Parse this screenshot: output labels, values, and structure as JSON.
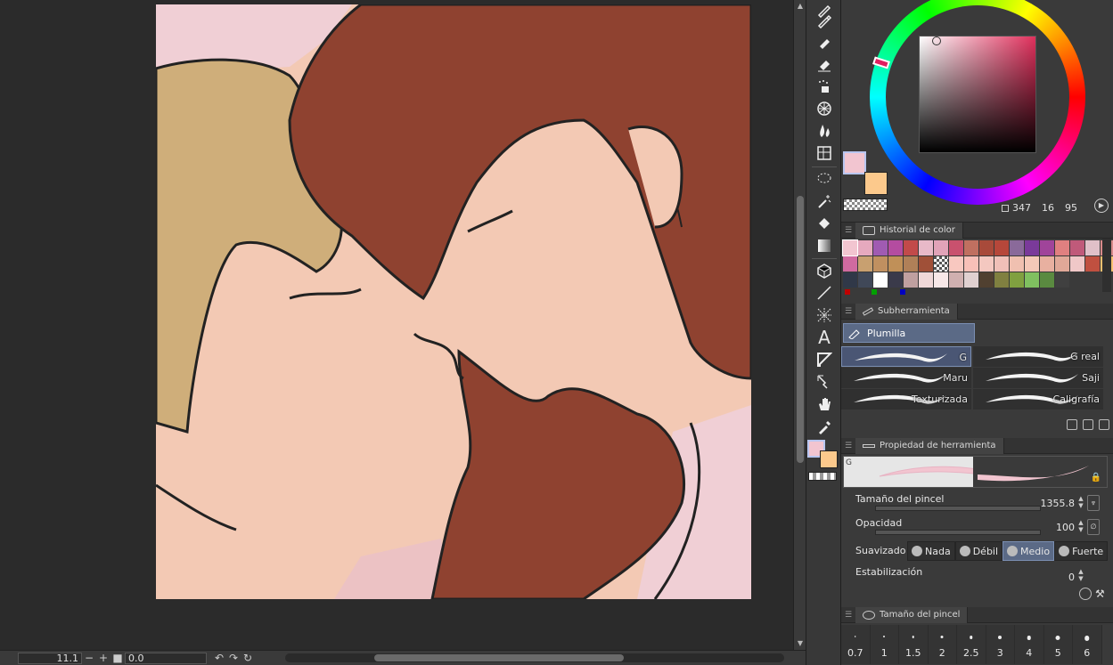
{
  "status_bar": {
    "zoom": "11.1",
    "rotation": "0.0"
  },
  "color_wheel": {
    "main_color": "#f2c5d0",
    "sub_color": "#fcc98c",
    "h": "347",
    "s": "16",
    "v": "95"
  },
  "color_history": {
    "tab_label": "Historial de color",
    "swatches": [
      "#f2c5d0",
      "#e6a9be",
      "#a05bb2",
      "#b44ca0",
      "#c24a4a",
      "#e8b9c8",
      "#e1a3b8",
      "#c9516e",
      "#c07060",
      "#a84a3a",
      "#b6473a",
      "#8a6a9a",
      "#7a3a9a",
      "#a0449a",
      "#e08080",
      "#c05a7a",
      "#e0c0c8",
      "#d98a8a",
      "#d06aa0",
      "#c8a070",
      "#c09060",
      "#c09058",
      "#b08058",
      "#a05038",
      "#checker",
      "#f8c8c0",
      "#f8c0b8",
      "#f4c8c0",
      "#f0c0b8",
      "#f0c0b0",
      "#f4c8b8",
      "#e8b0a0",
      "#e0a898",
      "#f0c8c8",
      "#c05040",
      "#f8c070",
      "#303848",
      "#404858",
      "#ffffff",
      "#3a3a4a",
      "#c0a0a0",
      "#f0d8d8",
      "#f8e8e8",
      "#d0b0b0",
      "#e0d0d0",
      "#504030",
      "#808040",
      "#80a040",
      "#80c060",
      "#5a8a40",
      "#404040"
    ]
  },
  "subtool": {
    "tab_label": "Subherramienta",
    "group_label": "Plumilla",
    "brushes": [
      {
        "name": "G",
        "active": true
      },
      {
        "name": "G real",
        "active": false
      },
      {
        "name": "Maru",
        "active": false
      },
      {
        "name": "Saji",
        "active": false
      },
      {
        "name": "Texturizada",
        "active": false
      },
      {
        "name": "Caligrafía",
        "active": false
      }
    ]
  },
  "tool_property": {
    "tab_label": "Propiedad de herramienta",
    "preview_label": "G",
    "brush_size_label": "Tamaño del pincel",
    "brush_size_value": "1355.8",
    "opacity_label": "Opacidad",
    "opacity_value": "100",
    "smoothing_label": "Suavizado",
    "smoothing_options": [
      {
        "label": "Nada",
        "active": false
      },
      {
        "label": "Débil",
        "active": false
      },
      {
        "label": "Medio",
        "active": true
      },
      {
        "label": "Fuerte",
        "active": false
      }
    ],
    "stabilization_label": "Estabilización",
    "stabilization_value": "0"
  },
  "brush_size_palette": {
    "tab_label": "Tamaño del pincel",
    "sizes": [
      "0.7",
      "1",
      "1.5",
      "2",
      "2.5",
      "3",
      "4",
      "5",
      "6"
    ]
  },
  "colors": {
    "hair_red": "#8f4230",
    "hair_blond": "#cfae7a",
    "skin": "#f3c9b4",
    "background_pink": "#f0cfd5",
    "accent_blue": "#5b6a86"
  }
}
